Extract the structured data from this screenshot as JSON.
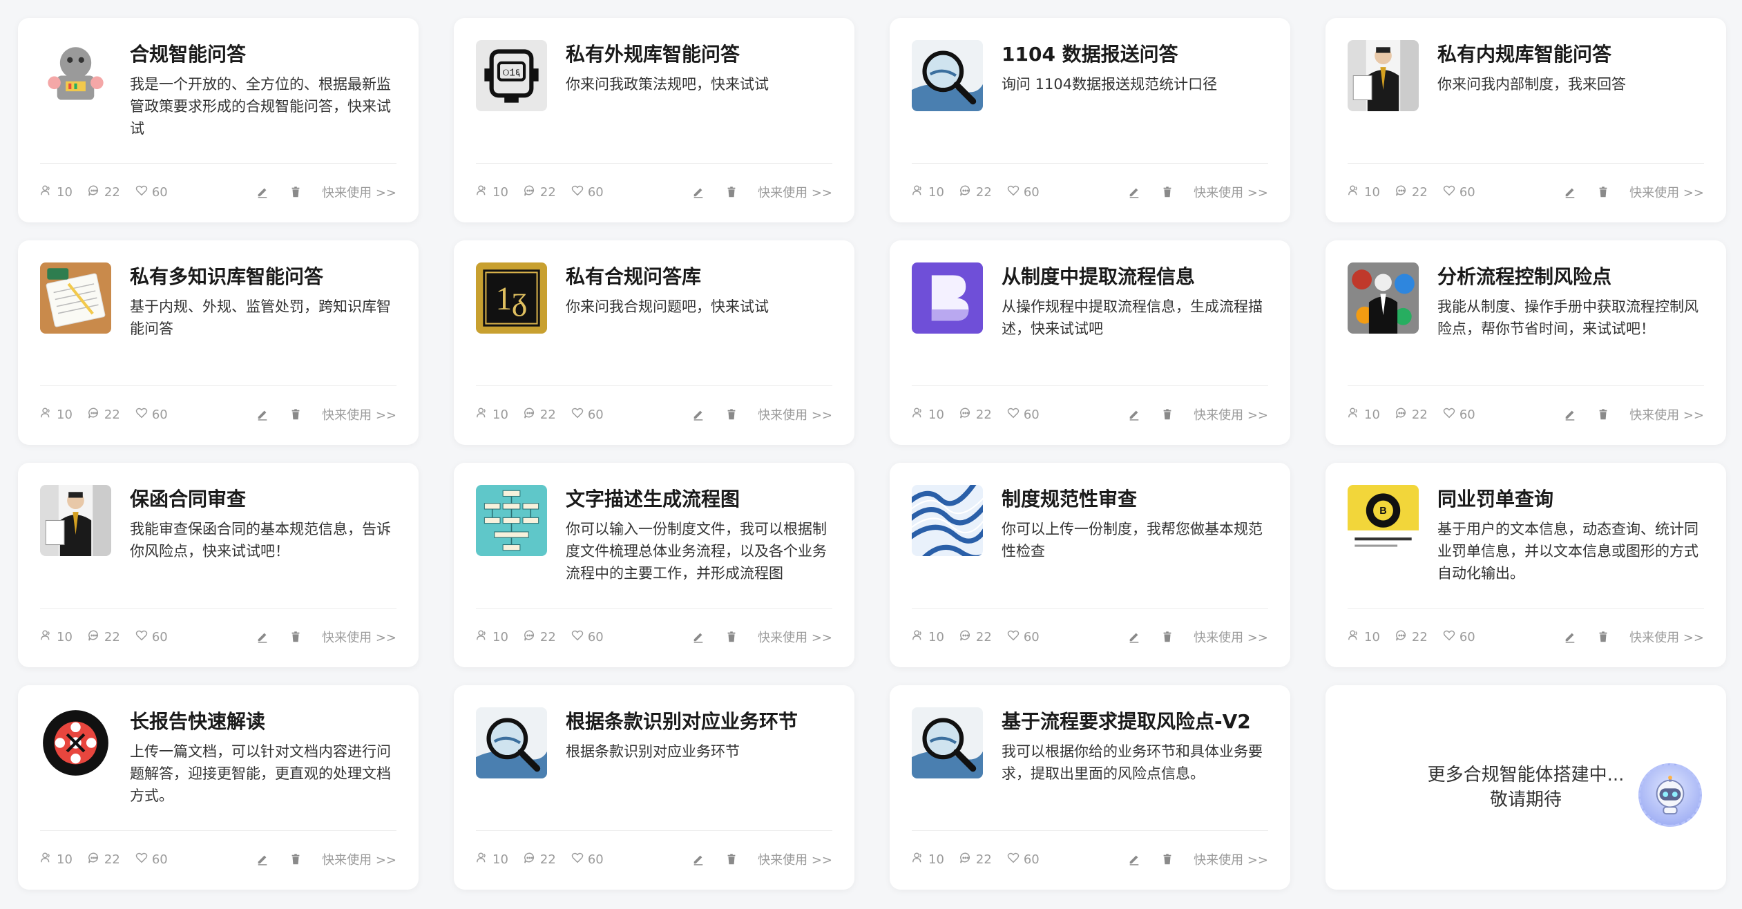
{
  "cards": [
    {
      "title": "合规智能问答",
      "desc": "我是一个开放的、全方位的、根据最新监管政策要求形成的合规智能问答，快来试试",
      "icon": "robot-icon",
      "users": "10",
      "comments": "22",
      "likes": "60",
      "use": "快来使用 >>"
    },
    {
      "title": "私有外规库智能问答",
      "desc": "你来问我政策法规吧，快来试试",
      "icon": "device-icon",
      "users": "10",
      "comments": "22",
      "likes": "60",
      "use": "快来使用 >>"
    },
    {
      "title": "1104 数据报送问答",
      "desc": "询问 1104数据报送规范统计口径",
      "icon": "magnifier-icon",
      "users": "10",
      "comments": "22",
      "likes": "60",
      "use": "快来使用 >>"
    },
    {
      "title": "私有内规库智能问答",
      "desc": "你来问我内部制度，我来回答",
      "icon": "businessman-icon",
      "users": "10",
      "comments": "22",
      "likes": "60",
      "use": "快来使用 >>"
    },
    {
      "title": "私有多知识库智能问答",
      "desc": "基于内规、外规、监管处罚，跨知识库智能问答",
      "icon": "notebook-icon",
      "users": "10",
      "comments": "22",
      "likes": "60",
      "use": "快来使用 >>"
    },
    {
      "title": "私有合规问答库",
      "desc": "你来问我合规问题吧，快来试试",
      "icon": "gold-frame-icon",
      "users": "10",
      "comments": "22",
      "likes": "60",
      "use": "快来使用 >>"
    },
    {
      "title": "从制度中提取流程信息",
      "desc": "从操作规程中提取流程信息，生成流程描述，快来试试吧",
      "icon": "b-logo-icon",
      "users": "10",
      "comments": "22",
      "likes": "60",
      "use": "快来使用 >>"
    },
    {
      "title": "分析流程控制风险点",
      "desc": "我能从制度、操作手册中获取流程控制风险点，帮你节省时间，来试试吧！",
      "icon": "suit-art-icon",
      "users": "10",
      "comments": "22",
      "likes": "60",
      "use": "快来使用 >>"
    },
    {
      "title": "保函合同审查",
      "desc": "我能审查保函合同的基本规范信息，告诉你风险点，快来试试吧！",
      "icon": "businessman-icon",
      "users": "10",
      "comments": "22",
      "likes": "60",
      "use": "快来使用 >>"
    },
    {
      "title": "文字描述生成流程图",
      "desc": "你可以输入一份制度文件，我可以根据制度文件梳理总体业务流程，以及各个业务流程中的主要工作，并形成流程图",
      "icon": "flowchart-icon",
      "users": "10",
      "comments": "22",
      "likes": "60",
      "use": "快来使用 >>"
    },
    {
      "title": "制度规范性审查",
      "desc": "你可以上传一份制度，我帮您做基本规范性检查",
      "icon": "wave-icon",
      "users": "10",
      "comments": "22",
      "likes": "60",
      "use": "快来使用 >>"
    },
    {
      "title": "同业罚单查询",
      "desc": "基于用户的文本信息，动态查询、统计同业罚单信息，并以文本信息或图形的方式自动化输出。",
      "icon": "coin-icon",
      "users": "10",
      "comments": "22",
      "likes": "60",
      "use": "快来使用 >>"
    },
    {
      "title": "长报告快速解读",
      "desc": "上传一篇文档，可以针对文档内容进行问题解答，迎接更智能，更直观的处理文档方式。",
      "icon": "circle-logo-icon",
      "users": "10",
      "comments": "22",
      "likes": "60",
      "use": "快来使用 >>"
    },
    {
      "title": "根据条款识别对应业务环节",
      "desc": "根据条款识别对应业务环节",
      "icon": "magnifier-icon",
      "users": "10",
      "comments": "22",
      "likes": "60",
      "use": "快来使用 >>"
    },
    {
      "title": "基于流程要求提取风险点-V2",
      "desc": "我可以根据你给的业务环节和具体业务要求，提取出里面的风险点信息。",
      "icon": "magnifier-icon",
      "users": "10",
      "comments": "22",
      "likes": "60",
      "use": "快来使用 >>"
    }
  ],
  "more": {
    "line1": "更多合规智能体搭建中...",
    "line2": "敬请期待"
  },
  "assistant": {
    "icon": "robot-assistant-icon"
  }
}
